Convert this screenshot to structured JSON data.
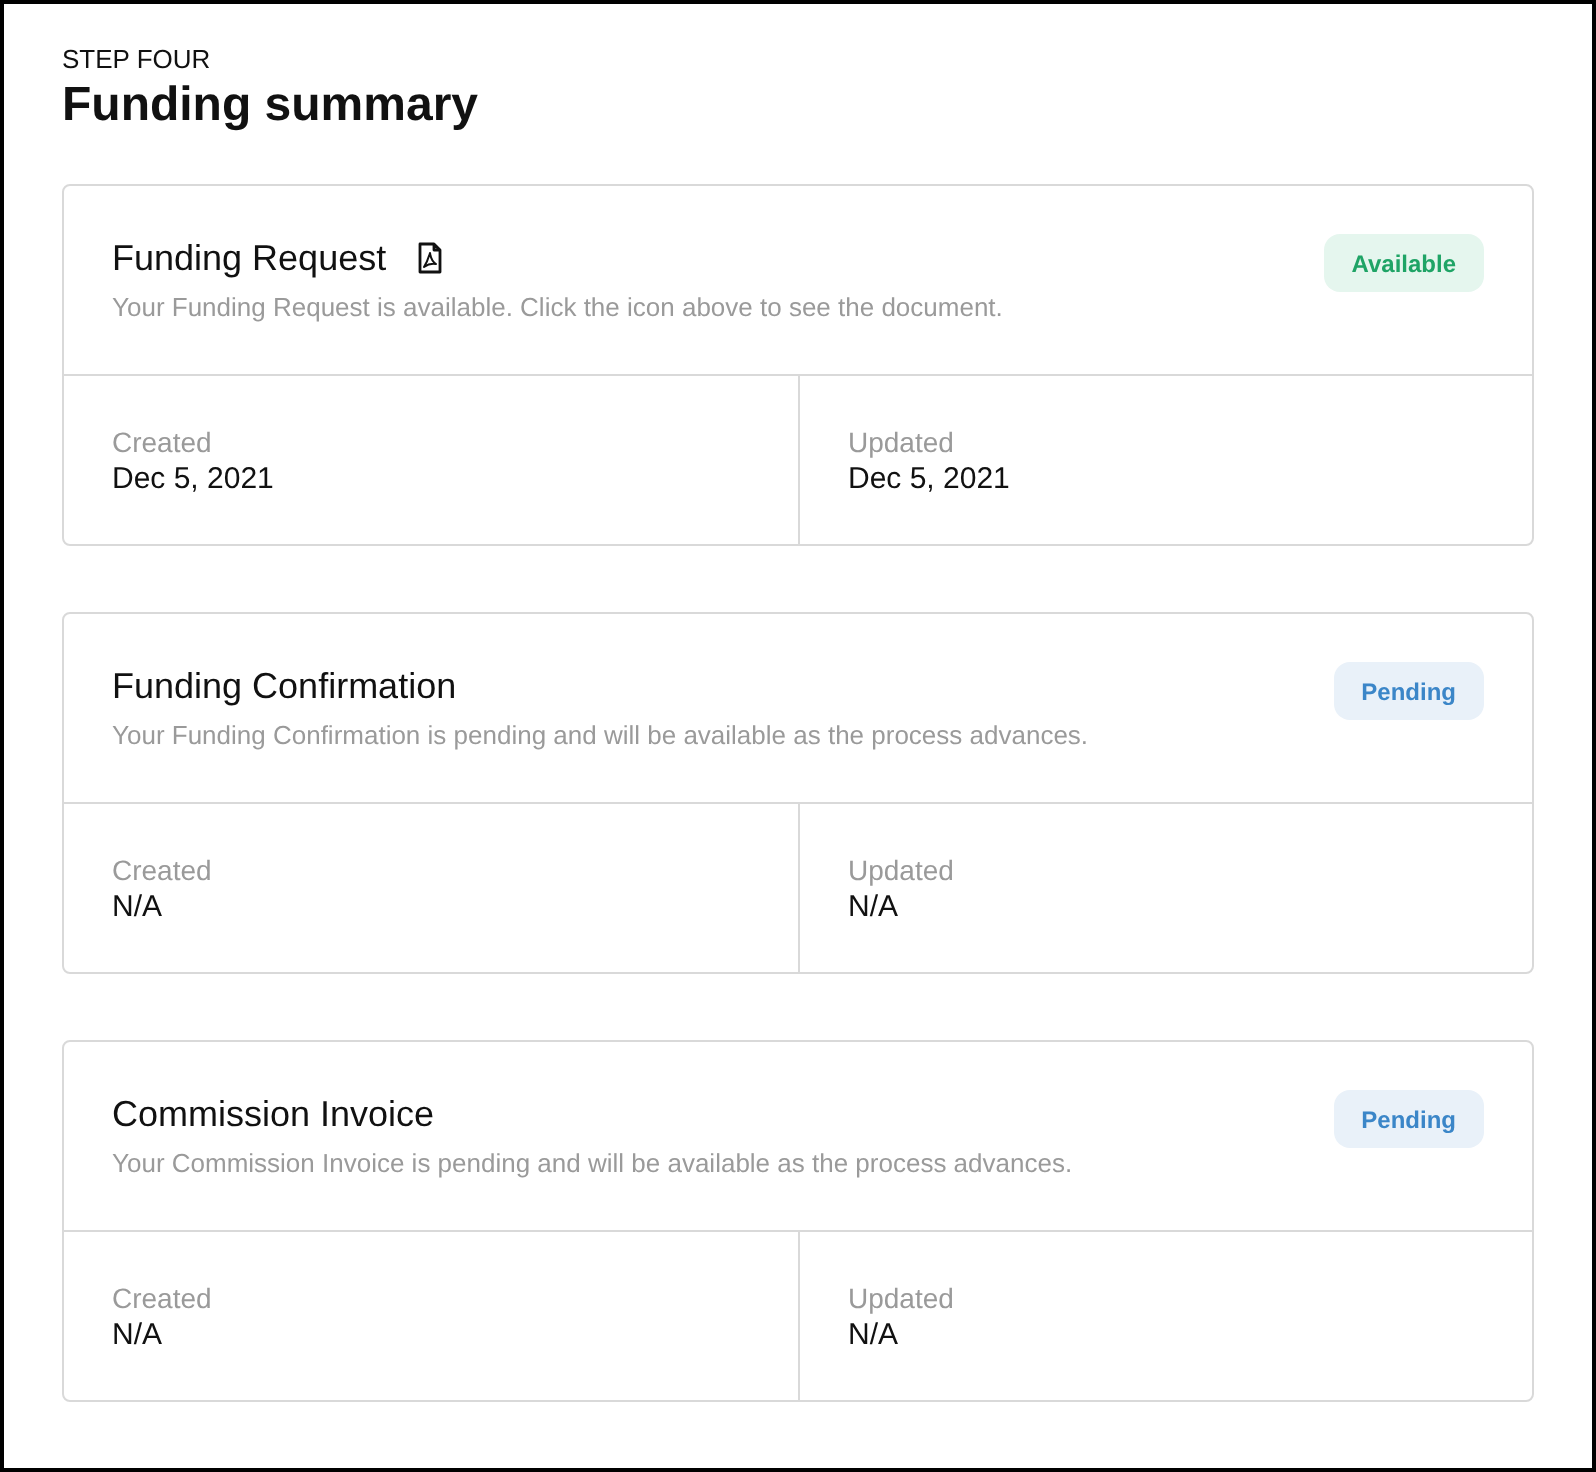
{
  "header": {
    "step": "STEP FOUR",
    "title": "Funding summary"
  },
  "documents": [
    {
      "title": "Funding Request",
      "document_icon": true,
      "description": "Your Funding Request is available. Click the icon above to see the document.",
      "status": {
        "label": "Available",
        "kind": "available"
      },
      "fields": [
        {
          "label": "Created",
          "value": "Dec 5, 2021"
        },
        {
          "label": "Updated",
          "value": "Dec 5, 2021"
        }
      ]
    },
    {
      "title": "Funding Confirmation",
      "document_icon": false,
      "description": "Your Funding Confirmation is pending and will be available as the process advances.",
      "status": {
        "label": "Pending",
        "kind": "pending"
      },
      "fields": [
        {
          "label": "Created",
          "value": "N/A"
        },
        {
          "label": "Updated",
          "value": "N/A"
        }
      ]
    },
    {
      "title": "Commission Invoice",
      "document_icon": false,
      "description": "Your Commission Invoice is pending and will be available as the process advances.",
      "status": {
        "label": "Pending",
        "kind": "pending"
      },
      "fields": [
        {
          "label": "Created",
          "value": "N/A"
        },
        {
          "label": "Updated",
          "value": "N/A"
        }
      ]
    }
  ]
}
